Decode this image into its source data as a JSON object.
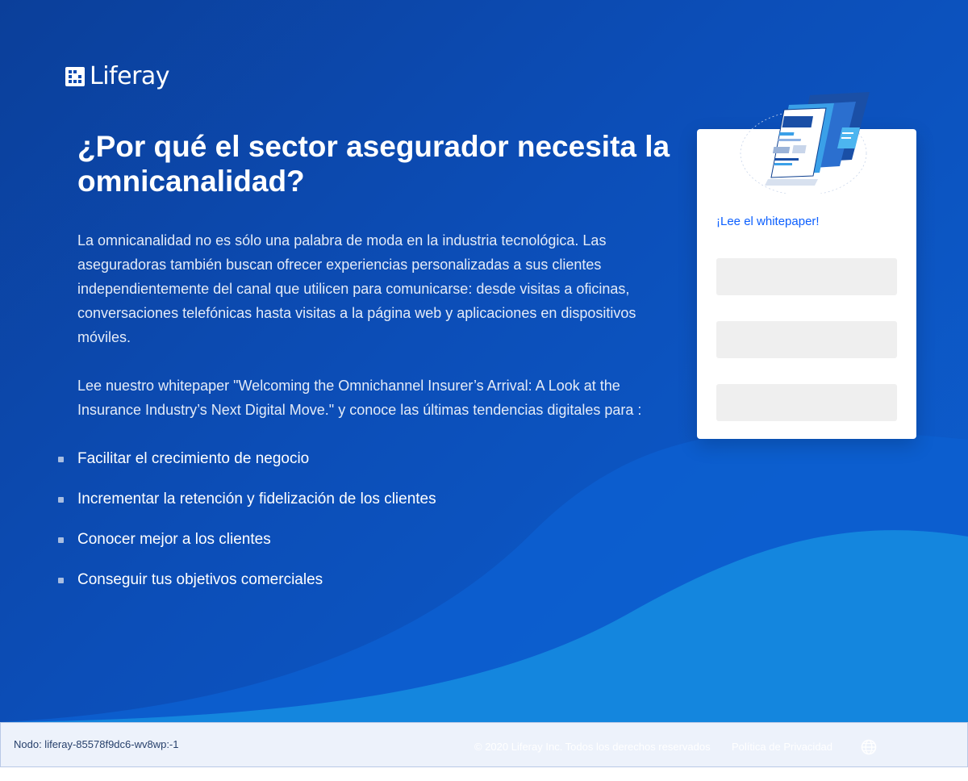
{
  "brand": {
    "logo_text": "Liferay"
  },
  "main": {
    "title": "¿Por qué el sector asegurador necesita la omnicanalidad?",
    "paragraph1": "La omnicanalidad no es sólo una palabra de moda en la industria tecnológica. Las aseguradoras también buscan ofrecer experiencias personalizadas a sus clientes independientemente del canal que utilicen para comunicarse: desde visitas a oficinas, conversaciones telefónicas hasta visitas a la página web y aplicaciones en dispositivos móviles.",
    "paragraph2": "Lee nuestro whitepaper \"Welcoming the Omnichannel Insurer’s Arrival: A Look at the Insurance Industry’s Next Digital Move.\" y conoce las últimas tendencias digitales para :",
    "bullets": [
      "Facilitar el crecimiento de negocio",
      "Incrementar la retención y fidelización de los clientes",
      "Conocer mejor a los clientes",
      "Conseguir tus objetivos comerciales"
    ]
  },
  "form_card": {
    "cta": "¡Lee el whitepaper!",
    "fields": [
      {
        "value": "",
        "placeholder": ""
      },
      {
        "value": "",
        "placeholder": ""
      },
      {
        "value": "",
        "placeholder": ""
      }
    ]
  },
  "footer": {
    "node": "Nodo: liferay-85578f9dc6-wv8wp:-1",
    "copyright": "© 2020 Liferay Inc. Todos los derechos reservados",
    "privacy": "Política de Privacidad",
    "language_icon": "globe-icon"
  },
  "colors": {
    "hero_dark": "#0b3f9a",
    "hero_light": "#0d5fd0",
    "wave_light": "#1486de",
    "link": "#0b5fff",
    "footer_bg": "#edf2fb"
  }
}
